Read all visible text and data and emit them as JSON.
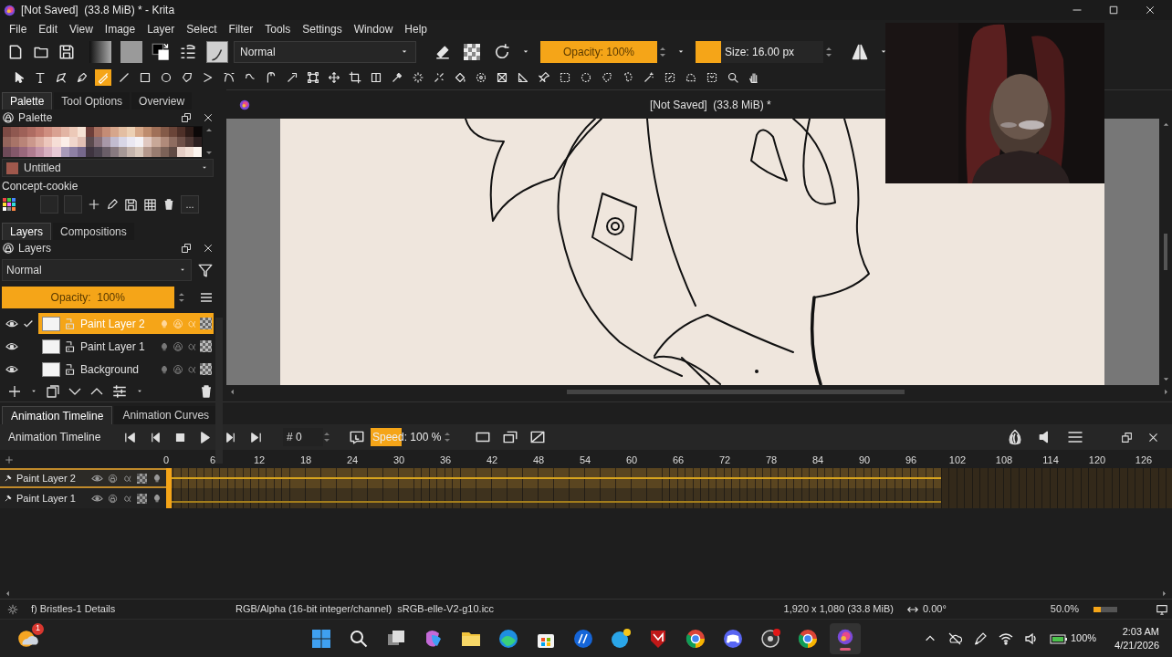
{
  "window": {
    "title": "[Not Saved]  (33.8 MiB) * - Krita"
  },
  "menu": [
    "File",
    "Edit",
    "View",
    "Image",
    "Layer",
    "Select",
    "Filter",
    "Tools",
    "Settings",
    "Window",
    "Help"
  ],
  "toolbar": {
    "blend_mode": "Normal",
    "opacity": {
      "label": "Opacity: 100%",
      "level": 1
    },
    "size": {
      "label": "Size: 16.00 px",
      "level": 0.2
    }
  },
  "tools": [
    {
      "kind": "pointer",
      "selected": false
    },
    {
      "kind": "text",
      "selected": false
    },
    {
      "kind": "shape",
      "selected": false
    },
    {
      "kind": "pen",
      "selected": false
    },
    {
      "kind": "brush",
      "selected": true
    },
    {
      "kind": "line",
      "selected": false
    },
    {
      "kind": "rectangle",
      "selected": false
    },
    {
      "kind": "ellipse",
      "selected": false
    },
    {
      "kind": "polygon",
      "selected": false
    },
    {
      "kind": "polyline",
      "selected": false
    },
    {
      "kind": "bezier",
      "selected": false
    },
    {
      "kind": "freehand",
      "selected": false
    },
    {
      "kind": "calligraphy",
      "selected": false
    },
    {
      "kind": "dynamic",
      "selected": false
    },
    {
      "kind": "transform",
      "selected": false
    },
    {
      "kind": "move",
      "selected": false
    },
    {
      "kind": "crop",
      "selected": false
    },
    {
      "kind": "gradient",
      "selected": false
    },
    {
      "kind": "eyedropper",
      "selected": false
    },
    {
      "kind": "multibrush",
      "selected": false
    },
    {
      "kind": "patch",
      "selected": false
    },
    {
      "kind": "fill",
      "selected": false
    },
    {
      "kind": "enclose",
      "selected": false
    },
    {
      "kind": "assistant",
      "selected": false
    },
    {
      "kind": "measure",
      "selected": false
    },
    {
      "kind": "reference",
      "selected": false
    },
    {
      "kind": "rectselect",
      "selected": false
    },
    {
      "kind": "ellipseselect",
      "selected": false
    },
    {
      "kind": "polyselect",
      "selected": false
    },
    {
      "kind": "freeselect",
      "selected": false
    },
    {
      "kind": "wand",
      "selected": false
    },
    {
      "kind": "similarselect",
      "selected": false
    },
    {
      "kind": "bezierselect",
      "selected": false
    },
    {
      "kind": "magneticselect",
      "selected": false
    },
    {
      "kind": "zoom",
      "selected": false
    },
    {
      "kind": "pan",
      "selected": false
    }
  ],
  "docker_tabs": [
    {
      "label": "Palette",
      "selected": true
    },
    {
      "label": "Tool Options",
      "selected": false
    },
    {
      "label": "Overview",
      "selected": false
    }
  ],
  "palette": {
    "title": "Palette",
    "palette_name": "Untitled",
    "set_name": "Concept-cookie",
    "more_button": "...",
    "swatches": [
      {
        "color": "#7d4b45"
      },
      {
        "color": "#8f5850"
      },
      {
        "color": "#9e6158"
      },
      {
        "color": "#ae6c62"
      },
      {
        "color": "#c07a6e"
      },
      {
        "color": "#cf8e80"
      },
      {
        "color": "#d9a192"
      },
      {
        "color": "#e2b4a4"
      },
      {
        "color": "#ecc9b8"
      },
      {
        "color": "#f6e2d4"
      },
      {
        "color": "#6e3f3a"
      },
      {
        "color": "#a8705f"
      },
      {
        "color": "#c48c76"
      },
      {
        "color": "#d6a68c"
      },
      {
        "color": "#e3bea2"
      },
      {
        "color": "#ecd0b4"
      },
      {
        "color": "#d7a98a"
      },
      {
        "color": "#be8c6e"
      },
      {
        "color": "#a07058"
      },
      {
        "color": "#845a48"
      },
      {
        "color": "#6a4438"
      },
      {
        "color": "#4e3028"
      },
      {
        "color": "#2e1c18"
      },
      {
        "color": "#0c0808"
      },
      {
        "color": "#94655c"
      },
      {
        "color": "#a87468"
      },
      {
        "color": "#b98478"
      },
      {
        "color": "#cb988c"
      },
      {
        "color": "#dcaea2"
      },
      {
        "color": "#ecc6bc"
      },
      {
        "color": "#f6ded6"
      },
      {
        "color": "#fbeee8"
      },
      {
        "color": "#f0d6cc"
      },
      {
        "color": "#e2c0b4"
      },
      {
        "color": "#5a4a4e"
      },
      {
        "color": "#86707a"
      },
      {
        "color": "#a898a8"
      },
      {
        "color": "#c2bcd0"
      },
      {
        "color": "#d8d6e6"
      },
      {
        "color": "#eae8f2"
      },
      {
        "color": "#f4f2f6"
      },
      {
        "color": "#e0c8c0"
      },
      {
        "color": "#c8a898"
      },
      {
        "color": "#b08a7a"
      },
      {
        "color": "#8e6c60"
      },
      {
        "color": "#6e5048"
      },
      {
        "color": "#4e3834"
      },
      {
        "color": "#2c2020"
      },
      {
        "color": "#6e4a58"
      },
      {
        "color": "#84586a"
      },
      {
        "color": "#9a687c"
      },
      {
        "color": "#b07c90"
      },
      {
        "color": "#c494a8"
      },
      {
        "color": "#d8b0c0"
      },
      {
        "color": "#e8cad6"
      },
      {
        "color": "#a89ab8"
      },
      {
        "color": "#8e80a4"
      },
      {
        "color": "#76688c"
      },
      {
        "color": "#3e3440"
      },
      {
        "color": "#4c4450"
      },
      {
        "color": "#6a5e68"
      },
      {
        "color": "#887a80"
      },
      {
        "color": "#a69896"
      },
      {
        "color": "#c4b4ac"
      },
      {
        "color": "#d8c8bc"
      },
      {
        "color": "#b4988c"
      },
      {
        "color": "#987c70"
      },
      {
        "color": "#7c6258"
      },
      {
        "color": "#604a44"
      },
      {
        "color": "#e6cfc6"
      },
      {
        "color": "#f2e0d6"
      },
      {
        "color": "#fdf6f0"
      }
    ]
  },
  "layer_tabs": [
    {
      "label": "Layers",
      "selected": true
    },
    {
      "label": "Compositions",
      "selected": false
    }
  ],
  "layers_panel": {
    "title": "Layers",
    "blend_mode": "Normal",
    "opacity": {
      "label": "Opacity:  100%",
      "level": 1
    },
    "layers": [
      {
        "name": "Paint Layer 2",
        "selected": true,
        "checked": true
      },
      {
        "name": "Paint Layer 1",
        "selected": false,
        "checked": false
      },
      {
        "name": "Background",
        "selected": false,
        "checked": false
      }
    ]
  },
  "canvas": {
    "title": "[Not Saved]  (33.8 MiB) *"
  },
  "timeline": {
    "tabs": [
      {
        "label": "Animation Timeline",
        "selected": true
      },
      {
        "label": "Animation Curves",
        "selected": false
      }
    ],
    "title": "Animation Timeline",
    "frame": "# 0",
    "speed": {
      "label": "Speed: 100 %",
      "level": 0.43
    },
    "ruler": [
      "0",
      "6",
      "12",
      "18",
      "24",
      "30",
      "36",
      "42",
      "48",
      "54",
      "60",
      "66",
      "72",
      "78",
      "84",
      "90",
      "96",
      "102",
      "108",
      "114",
      "120",
      "126"
    ],
    "playback_range": {
      "level": 0.77
    },
    "layers": [
      {
        "name": "Paint Layer 2",
        "selected": true
      },
      {
        "name": "Paint Layer 1",
        "selected": false
      }
    ]
  },
  "status_bar": {
    "brush": "f) Bristles-1 Details",
    "color_space": "RGB/Alpha (16-bit integer/channel)  sRGB-elle-V2-g10.icc",
    "dimensions": "1,920 x 1,080 (33.8 MiB)",
    "rotation": "0.00°",
    "zoom": {
      "label": "50.0%",
      "level": 0.3
    }
  },
  "taskbar": {
    "weather_badge": "1",
    "battery": "100%",
    "time": "2:03 AM",
    "date": "4/21/2026"
  }
}
